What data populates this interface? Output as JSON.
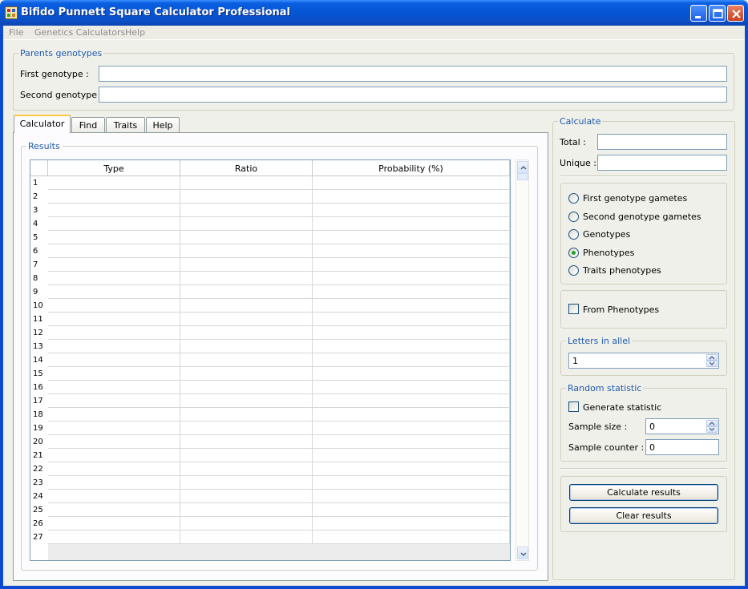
{
  "window": {
    "title": "Bifido Punnett Square Calculator Professional"
  },
  "menu": [
    "File",
    "Genetics Calculators",
    "Help"
  ],
  "parents": {
    "group_title": "Parents genotypes",
    "first_label": "First genotype :",
    "first_value": "",
    "second_label": "Second genotype :",
    "second_value": ""
  },
  "tabs": [
    "Calculator",
    "Find",
    "Traits",
    "Help"
  ],
  "active_tab": "Calculator",
  "results": {
    "group_title": "Results",
    "columns": [
      "Type",
      "Ratio",
      "Probability (%)"
    ],
    "row_numbers": [
      "1",
      "2",
      "3",
      "4",
      "5",
      "6",
      "7",
      "8",
      "9",
      "10",
      "11",
      "12",
      "13",
      "14",
      "15",
      "16",
      "17",
      "18",
      "19",
      "20",
      "21",
      "22",
      "23",
      "24",
      "25",
      "26",
      "27"
    ]
  },
  "calculate": {
    "group_title": "Calculate",
    "total_label": "Total :",
    "total_value": "",
    "unique_label": "Unique :",
    "unique_value": "",
    "options": [
      "First genotype gametes",
      "Second genotype gametes",
      "Genotypes",
      "Phenotypes",
      "Traits phenotypes"
    ],
    "selected_option": "Phenotypes",
    "from_phenotypes_label": "From Phenotypes",
    "from_phenotypes_checked": false
  },
  "letters": {
    "group_title": "Letters in allel",
    "value": "1"
  },
  "random": {
    "group_title": "Random statistic",
    "generate_label": "Generate statistic",
    "generate_checked": false,
    "sample_size_label": "Sample size :",
    "sample_size_value": "0",
    "sample_counter_label": "Sample counter :",
    "sample_counter_value": "0"
  },
  "buttons": {
    "calculate_label": "Calculate results",
    "clear_label": "Clear results"
  },
  "colors": {
    "titlebar": "#0a50c8",
    "group_title": "#1f5ab0",
    "radio_dot": "#21a121",
    "active_tab_accent": "#ffc83c"
  }
}
